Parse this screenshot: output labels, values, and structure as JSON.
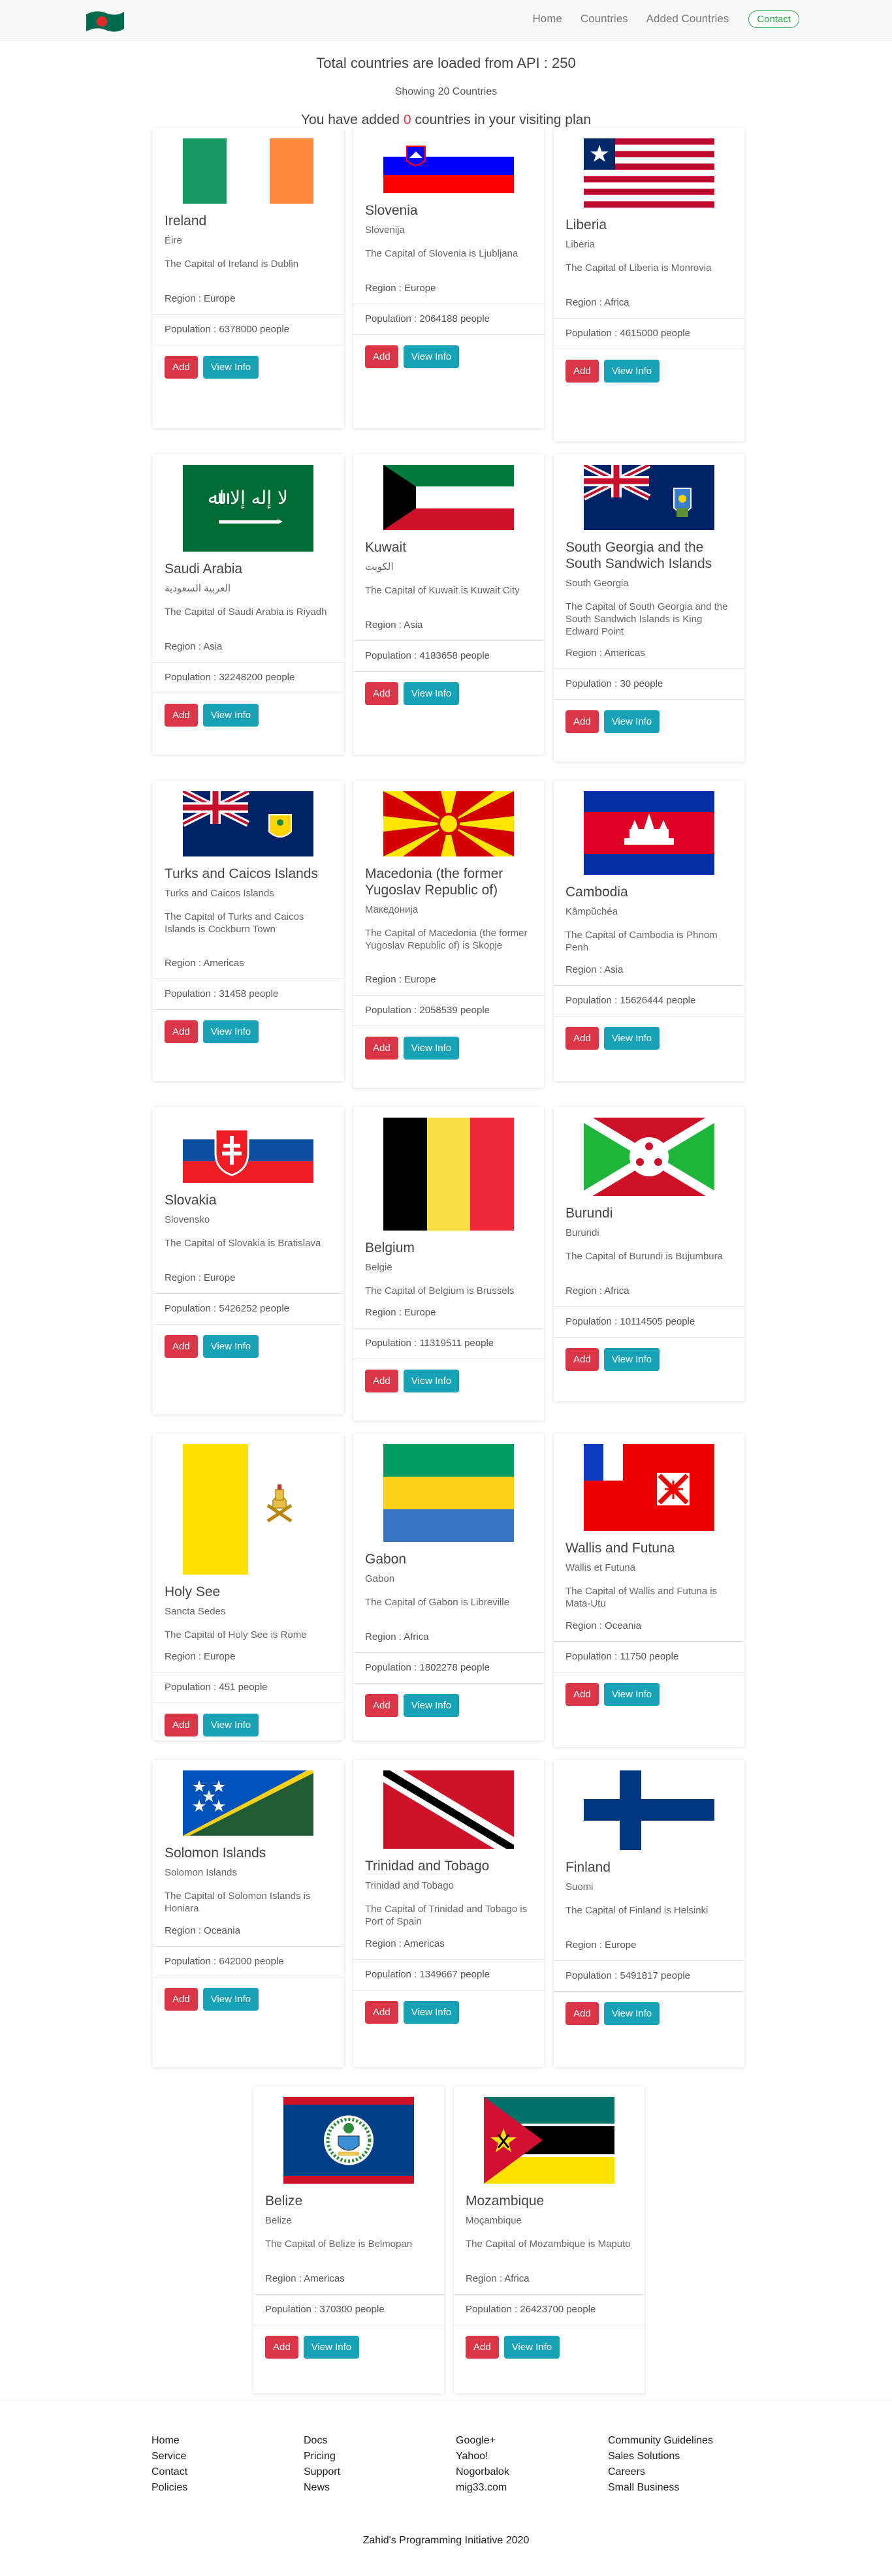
{
  "nav": {
    "links": [
      "Home",
      "Countries",
      "Added Countries"
    ],
    "contact_label": "Contact"
  },
  "header": {
    "total_text": "Total countries are loaded from API : 250",
    "showing_text": "Showing 20 Countries",
    "added_prefix": "You have added ",
    "added_count": "0",
    "added_suffix": " countries in your visiting plan"
  },
  "buttons": {
    "add_label": "Add",
    "info_label": "View Info"
  },
  "countries": [
    {
      "name": "Ireland",
      "native": "Éire",
      "capital_text": "The Capital of Ireland is Dublin",
      "region": "Region : Europe",
      "population": "Population : 6378000 people"
    },
    {
      "name": "Slovenia",
      "native": "Slovenija",
      "capital_text": "The Capital of Slovenia is Ljubljana",
      "region": "Region : Europe",
      "population": "Population : 2064188 people"
    },
    {
      "name": "Liberia",
      "native": "Liberia",
      "capital_text": "The Capital of Liberia is Monrovia",
      "region": "Region : Africa",
      "population": "Population : 4615000 people"
    },
    {
      "name": "Saudi Arabia",
      "native": "العربية السعودية",
      "capital_text": "The Capital of Saudi Arabia is Riyadh",
      "region": "Region : Asia",
      "population": "Population : 32248200 people"
    },
    {
      "name": "Kuwait",
      "native": "الكويت",
      "capital_text": "The Capital of Kuwait is Kuwait City",
      "region": "Region : Asia",
      "population": "Population : 4183658 people"
    },
    {
      "name": "South Georgia and the South Sandwich Islands",
      "native": "South Georgia",
      "capital_text": "The Capital of South Georgia and the South Sandwich Islands is King Edward Point",
      "region": "Region : Americas",
      "population": "Population : 30 people"
    },
    {
      "name": "Turks and Caicos Islands",
      "native": "Turks and Caicos Islands",
      "capital_text": "The Capital of Turks and Caicos Islands is Cockburn Town",
      "region": "Region : Americas",
      "population": "Population : 31458 people"
    },
    {
      "name": "Macedonia (the former Yugoslav Republic of)",
      "native": "Македонија",
      "capital_text": "The Capital of Macedonia (the former Yugoslav Republic of) is Skopje",
      "region": "Region : Europe",
      "population": "Population : 2058539 people"
    },
    {
      "name": "Cambodia",
      "native": "Kâmpŭchéa",
      "capital_text": "The Capital of Cambodia is Phnom Penh",
      "region": "Region : Asia",
      "population": "Population : 15626444 people"
    },
    {
      "name": "Slovakia",
      "native": "Slovensko",
      "capital_text": "The Capital of Slovakia is Bratislava",
      "region": "Region : Europe",
      "population": "Population : 5426252 people"
    },
    {
      "name": "Belgium",
      "native": "België",
      "capital_text": "The Capital of Belgium is Brussels",
      "region": "Region : Europe",
      "population": "Population : 11319511 people"
    },
    {
      "name": "Burundi",
      "native": "Burundi",
      "capital_text": "The Capital of Burundi is Bujumbura",
      "region": "Region : Africa",
      "population": "Population : 10114505 people"
    },
    {
      "name": "Holy See",
      "native": "Sancta Sedes",
      "capital_text": "The Capital of Holy See is Rome",
      "region": "Region : Europe",
      "population": "Population : 451 people"
    },
    {
      "name": "Gabon",
      "native": "Gabon",
      "capital_text": "The Capital of Gabon is Libreville",
      "region": "Region : Africa",
      "population": "Population : 1802278 people"
    },
    {
      "name": "Wallis and Futuna",
      "native": "Wallis et Futuna",
      "capital_text": "The Capital of Wallis and Futuna is Mata-Utu",
      "region": "Region : Oceania",
      "population": "Population : 11750 people"
    },
    {
      "name": "Solomon Islands",
      "native": "Solomon Islands",
      "capital_text": "The Capital of Solomon Islands is Honiara",
      "region": "Region : Oceania",
      "population": "Population : 642000 people"
    },
    {
      "name": "Trinidad and Tobago",
      "native": "Trinidad and Tobago",
      "capital_text": "The Capital of Trinidad and Tobago is Port of Spain",
      "region": "Region : Americas",
      "population": "Population : 1349667 people"
    },
    {
      "name": "Finland",
      "native": "Suomi",
      "capital_text": "The Capital of Finland is Helsinki",
      "region": "Region : Europe",
      "population": "Population : 5491817 people"
    },
    {
      "name": "Belize",
      "native": "Belize",
      "capital_text": "The Capital of Belize is Belmopan",
      "region": "Region : Americas",
      "population": "Population : 370300 people"
    },
    {
      "name": "Mozambique",
      "native": "Moçambique",
      "capital_text": "The Capital of Mozambique is Maputo",
      "region": "Region : Africa",
      "population": "Population : 26423700 people"
    }
  ],
  "footer": {
    "col1": [
      "Home",
      "Service",
      "Contact",
      "Policies"
    ],
    "col2": [
      "Docs",
      "Pricing",
      "Support",
      "News"
    ],
    "col3": [
      "Google+",
      "Yahoo!",
      "Nogorbalok",
      "mig33.com"
    ],
    "col4": [
      "Community Guidelines",
      "Sales Solutions",
      "Careers",
      "Small Business"
    ],
    "copyright": "Zahid's Programming Initiative 2020"
  }
}
